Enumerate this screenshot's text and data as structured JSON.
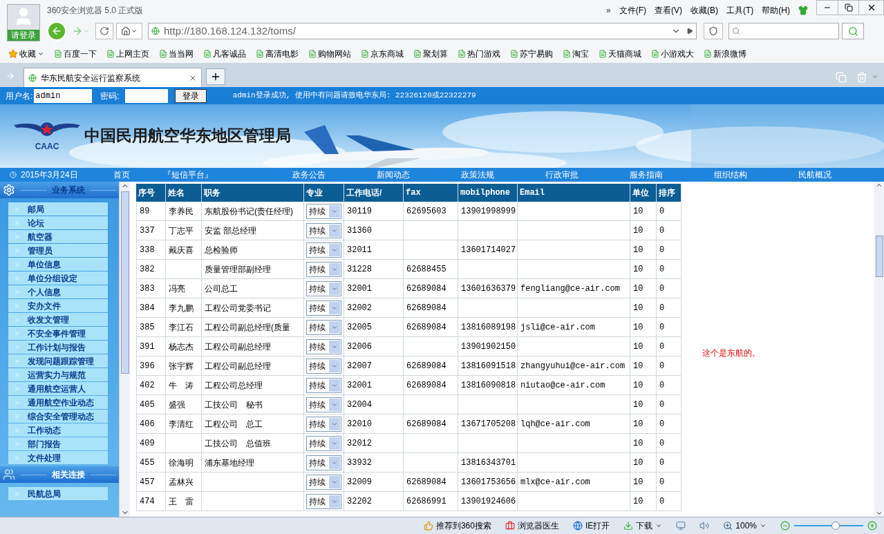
{
  "browser": {
    "avatar_label": "请登录",
    "title": "360安全浏览器 5.0 正式版",
    "more": "»",
    "menu": [
      "文件(F)",
      "查看(V)",
      "收藏(B)",
      "工具(T)",
      "帮助(H)"
    ],
    "address": "http://180.168.124.132/toms/",
    "favorites_label": "收藏",
    "bookmarks": [
      "百度一下",
      "上网主页",
      "当当网",
      "凡客诚品",
      "高清电影",
      "购物网站",
      "京东商城",
      "聚划算",
      "热门游戏",
      "苏宁易购",
      "淘宝",
      "天猫商城",
      "小游戏大",
      "新浪微博"
    ],
    "tabs": [
      {
        "title": "华东民航安全运行监察系统",
        "selected": true
      }
    ]
  },
  "login": {
    "username_label": "用户名:",
    "username": "admin",
    "password_label": "密码:",
    "button": "登录",
    "message": "admin登录成功, 使用中有问题请致电华东局: 22326120或22322279"
  },
  "banner": {
    "logo_text": "CAAC",
    "title": "中国民用航空华东地区管理局"
  },
  "nav": {
    "date": "2015年3月24日",
    "items": [
      "首页",
      "『短信平台』",
      "政务公告",
      "新闻动态",
      "政策法规",
      "行政审批",
      "服务指南",
      "组织结构",
      "民航概况"
    ]
  },
  "sidebar": [
    {
      "title": "业务系统",
      "kind": "system",
      "items": [
        "邮局",
        "论坛",
        "航空器",
        "管理员",
        "单位信息",
        "单位分组设定",
        "个人信息",
        "安办文件",
        "收发文管理",
        "不安全事件管理",
        "工作计划与报告",
        "发现问题跟踪管理",
        "运营实力与规范",
        "通用航空运营人",
        "通用航空作业动态",
        "综合安全管理动态",
        "工作动态",
        "部门报告",
        "文件处理"
      ]
    },
    {
      "title": "相关连接",
      "kind": "links",
      "items": [
        "民航总局"
      ]
    }
  ],
  "table": {
    "columns": [
      "序号",
      "姓名",
      "职务",
      "专业",
      "工作电话/",
      "fax",
      "mobilphone",
      "Email",
      "单位",
      "排序"
    ],
    "rows": [
      {
        "id": "89",
        "name": "李养民",
        "title": "东航股份书记(责任经理)",
        "specialty": "持续",
        "phone": "30119",
        "fax": "62695603",
        "mobile": "13901998999",
        "email": "",
        "unit": "10",
        "order": "0"
      },
      {
        "id": "337",
        "name": "丁志平",
        "title": "安监 部总经理",
        "specialty": "持续",
        "phone": "31360",
        "fax": "",
        "mobile": "",
        "email": "",
        "unit": "10",
        "order": "0"
      },
      {
        "id": "338",
        "name": "戴庆喜",
        "title": "总检验师",
        "specialty": "持续",
        "phone": "32011",
        "fax": "",
        "mobile": "13601714027",
        "email": "",
        "unit": "10",
        "order": "0"
      },
      {
        "id": "382",
        "name": "",
        "title": "质量管理部副经理",
        "specialty": "持续",
        "phone": "31228",
        "fax": "62688455",
        "mobile": "",
        "email": "",
        "unit": "10",
        "order": "0"
      },
      {
        "id": "383",
        "name": "冯亮",
        "title": "公司总工",
        "specialty": "持续",
        "phone": "32001",
        "fax": "62689084",
        "mobile": "13601636379",
        "email": "fengliang@ce-air.com",
        "unit": "10",
        "order": "0"
      },
      {
        "id": "384",
        "name": "李九鹏",
        "title": "工程公司党委书记",
        "specialty": "持续",
        "phone": "32002",
        "fax": "62689084",
        "mobile": "",
        "email": "",
        "unit": "10",
        "order": "0"
      },
      {
        "id": "385",
        "name": "李江石",
        "title": "工程公司副总经理(质量",
        "specialty": "持续",
        "phone": "32005",
        "fax": "62689084",
        "mobile": "13816089198",
        "email": "jsli@ce-air.com",
        "unit": "10",
        "order": "0"
      },
      {
        "id": "391",
        "name": "杨志杰",
        "title": "工程公司副总经理",
        "specialty": "持续",
        "phone": "32006",
        "fax": "",
        "mobile": "13901902150",
        "email": "",
        "unit": "10",
        "order": "0"
      },
      {
        "id": "396",
        "name": "张宇辉",
        "title": "工程公司副总经理",
        "specialty": "持续",
        "phone": "32007",
        "fax": "62689084",
        "mobile": "13816091518",
        "email": "zhangyuhui@ce-air.com",
        "unit": "10",
        "order": "0"
      },
      {
        "id": "402",
        "name": "牛　涛",
        "title": "工程公司总经理",
        "specialty": "持续",
        "phone": "32001",
        "fax": "62689084",
        "mobile": "13816090818",
        "email": "niutao@ce-air.com",
        "unit": "10",
        "order": "0"
      },
      {
        "id": "405",
        "name": "盛强",
        "title": "工技公司　秘书",
        "specialty": "持续",
        "phone": "32004",
        "fax": "",
        "mobile": "",
        "email": "",
        "unit": "10",
        "order": "0"
      },
      {
        "id": "406",
        "name": "李清红",
        "title": "工程公司　总工",
        "specialty": "持续",
        "phone": "32010",
        "fax": "62689084",
        "mobile": "13671705208",
        "email": "lqh@ce-air.com",
        "unit": "10",
        "order": "0"
      },
      {
        "id": "409",
        "name": "",
        "title": "工技公司　总值班",
        "specialty": "持续",
        "phone": "32012",
        "fax": "",
        "mobile": "",
        "email": "",
        "unit": "10",
        "order": "0"
      },
      {
        "id": "455",
        "name": "徐海明",
        "title": "浦东基地经理",
        "specialty": "持续",
        "phone": "33932",
        "fax": "",
        "mobile": "13816343701",
        "email": "",
        "unit": "10",
        "order": "0"
      },
      {
        "id": "457",
        "name": "孟林兴",
        "title": "",
        "specialty": "持续",
        "phone": "32009",
        "fax": "62689084",
        "mobile": "13601753656",
        "email": "mlx@ce-air.com",
        "unit": "10",
        "order": "0"
      },
      {
        "id": "474",
        "name": "王　雷",
        "title": "",
        "specialty": "持续",
        "phone": "32202",
        "fax": "62686991",
        "mobile": "13901924606",
        "email": "",
        "unit": "10",
        "order": "0"
      }
    ]
  },
  "note": "这个是东航的。",
  "status_bar": {
    "recommend": "推荐到360搜索",
    "doctor": "浏览器医生",
    "ie_open": "IE打开",
    "download": "下载",
    "zoom": "100%",
    "zoom_slider": {
      "level": 0.6
    }
  }
}
